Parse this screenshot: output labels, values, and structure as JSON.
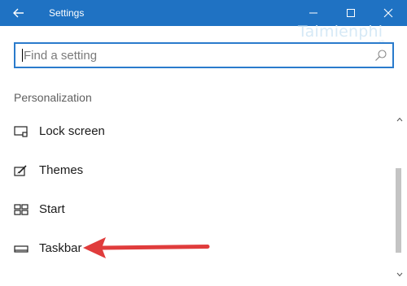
{
  "window": {
    "title": "Settings"
  },
  "icons": {
    "back": "back-arrow-icon",
    "minimize": "minimize-icon",
    "maximize": "maximize-icon",
    "close": "close-icon",
    "search": "search-icon"
  },
  "watermark": {
    "brand": "Taimienphi",
    "tld": ".vn"
  },
  "search": {
    "placeholder": "Find a setting",
    "value": ""
  },
  "section": {
    "title": "Personalization"
  },
  "nav_items": [
    {
      "label": "Lock screen",
      "icon": "lock-screen-icon"
    },
    {
      "label": "Themes",
      "icon": "themes-icon"
    },
    {
      "label": "Start",
      "icon": "start-icon"
    },
    {
      "label": "Taskbar",
      "icon": "taskbar-icon"
    }
  ],
  "colors": {
    "titlebar": "#1f72c3",
    "accent": "#2a7bcc",
    "annotation_arrow": "#e03c3c"
  }
}
